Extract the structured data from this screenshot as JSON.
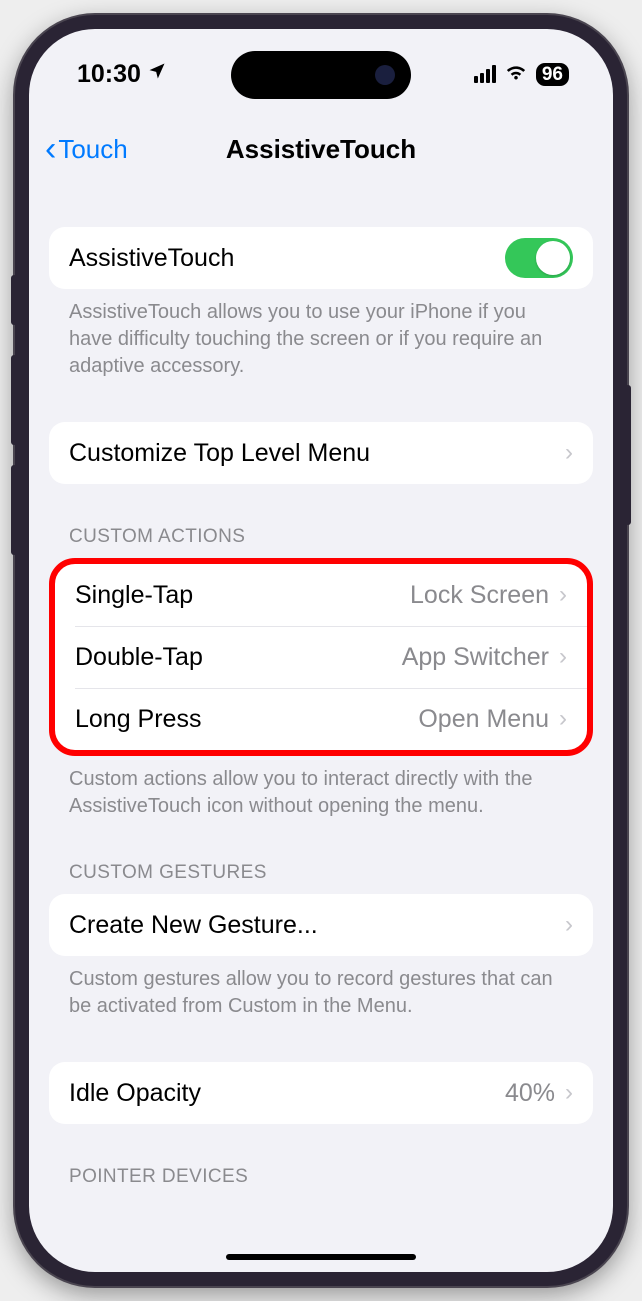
{
  "status": {
    "time": "10:30",
    "battery": "96"
  },
  "nav": {
    "back_label": "Touch",
    "title": "AssistiveTouch"
  },
  "groups": {
    "at_toggle_label": "AssistiveTouch",
    "at_toggle_desc": "AssistiveTouch allows you to use your iPhone if you have difficulty touching the screen or if you require an adaptive accessory.",
    "customize_label": "Customize Top Level Menu",
    "custom_actions_header": "CUSTOM ACTIONS",
    "custom_actions_footer": "Custom actions allow you to interact directly with the AssistiveTouch icon without opening the menu.",
    "actions": {
      "single_tap_label": "Single-Tap",
      "single_tap_value": "Lock Screen",
      "double_tap_label": "Double-Tap",
      "double_tap_value": "App Switcher",
      "long_press_label": "Long Press",
      "long_press_value": "Open Menu"
    },
    "custom_gestures_header": "CUSTOM GESTURES",
    "create_gesture_label": "Create New Gesture...",
    "custom_gestures_footer": "Custom gestures allow you to record gestures that can be activated from Custom in the Menu.",
    "idle_opacity_label": "Idle Opacity",
    "idle_opacity_value": "40%",
    "pointer_devices_header": "POINTER DEVICES"
  }
}
